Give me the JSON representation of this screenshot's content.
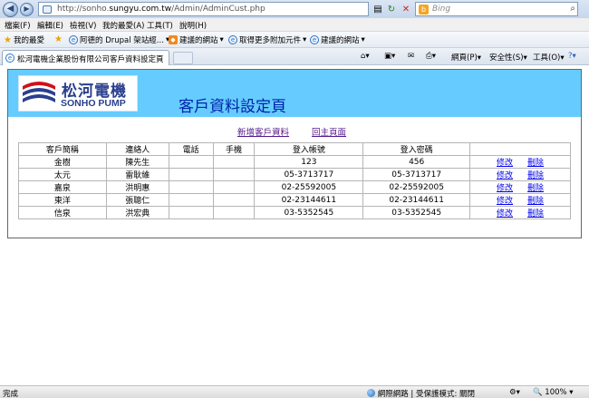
{
  "browser": {
    "url_prefix": "http://sonho.",
    "url_domain": "sungyu.com.tw",
    "url_path": "/Admin/AdminCust.php",
    "search_placeholder": "Bing"
  },
  "menu": [
    "檔案(F)",
    "編輯(E)",
    "檢視(V)",
    "我的最愛(A)",
    "工具(T)",
    "說明(H)"
  ],
  "favorites": {
    "main": "我的最愛",
    "items": [
      "阿德的 Drupal 架站經...",
      "建議的網站",
      "取得更多附加元件",
      "建議的網站"
    ]
  },
  "tab": {
    "title": "松河電機企業股份有限公司客戶資料設定頁"
  },
  "command_bar": {
    "page": "網頁(P)",
    "safety": "安全性(S)",
    "tools": "工具(O)"
  },
  "page": {
    "logo_cn": "松河電機",
    "logo_en": "SONHO PUMP",
    "title": "客戶資料設定頁",
    "add_link": "新增客戶資料",
    "home_link": "回主頁面",
    "headers": [
      "客戶簡稱",
      "連絡人",
      "電話",
      "手機",
      "登入帳號",
      "登入密碼"
    ],
    "edit_label": "修改",
    "delete_label": "刪除",
    "rows": [
      {
        "name": "金樹",
        "contact": "陳先生",
        "phone": "",
        "mobile": "",
        "account": "123",
        "password": "456"
      },
      {
        "name": "太元",
        "contact": "雷耿維",
        "phone": "",
        "mobile": "",
        "account": "05-3713717",
        "password": "05-3713717"
      },
      {
        "name": "嘉泉",
        "contact": "洪明惠",
        "phone": "",
        "mobile": "",
        "account": "02-25592005",
        "password": "02-25592005"
      },
      {
        "name": "東洋",
        "contact": "張聰仁",
        "phone": "",
        "mobile": "",
        "account": "02-23144611",
        "password": "02-23144611"
      },
      {
        "name": "信泉",
        "contact": "洪宏典",
        "phone": "",
        "mobile": "",
        "account": "03-5352545",
        "password": "03-5352545"
      }
    ]
  },
  "status": {
    "left": "完成",
    "zone": "網際網路 | 受保護模式: 關閉",
    "zoom": "100%"
  }
}
